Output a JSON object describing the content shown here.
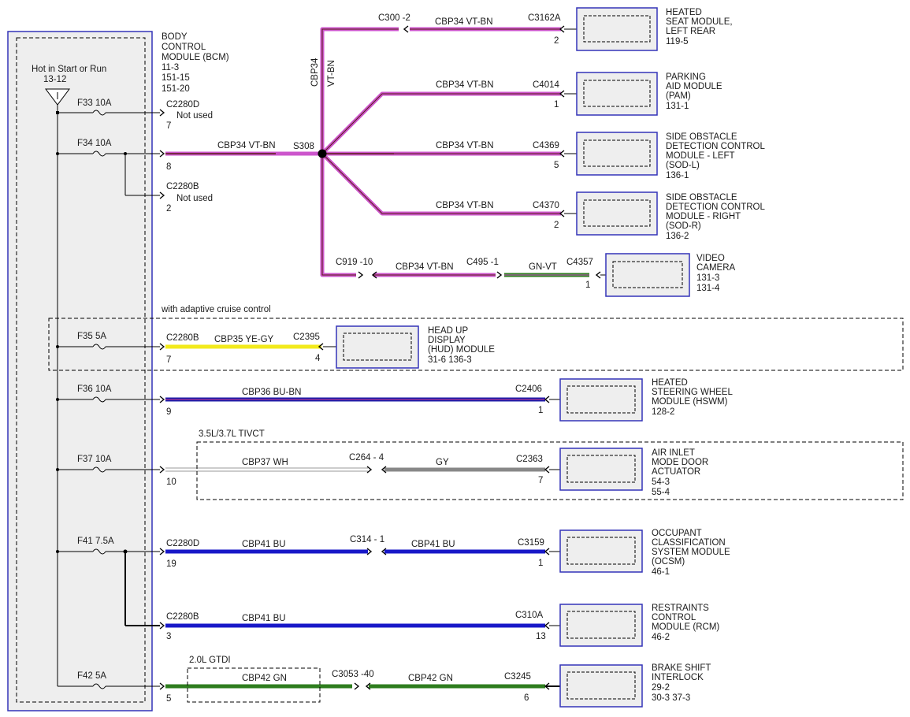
{
  "bcm": {
    "label": [
      "BODY",
      "CONTROL",
      "MODULE (BCM)"
    ],
    "refs": [
      "11-3",
      "151-15",
      "151-20"
    ],
    "hot_label": "Hot in Start or Run",
    "hot_ref": "13-12"
  },
  "fuses": [
    {
      "label": "F33  10A"
    },
    {
      "label": "F34  10A"
    },
    {
      "label": "F35  5A"
    },
    {
      "label": "F36  10A"
    },
    {
      "label": "F37  10A"
    },
    {
      "label": "F41  7.5A"
    },
    {
      "label": "F42  5A"
    }
  ],
  "notes": {
    "acc": "with adaptive cruise control",
    "tivct": "3.5L/3.7L TIVCT",
    "gtdi": "2.0L GTDI"
  },
  "splice": "S308",
  "bcm_connectors": [
    {
      "name": "C2280D",
      "pin": "7",
      "extra": "Not used"
    },
    {
      "name": "",
      "pin": "8",
      "extra": ""
    },
    {
      "name": "C2280B",
      "pin": "2",
      "extra": "Not used"
    },
    {
      "name": "C2280B",
      "pin": "7",
      "extra": ""
    },
    {
      "name": "",
      "pin": "9",
      "extra": ""
    },
    {
      "name": "",
      "pin": "10",
      "extra": ""
    },
    {
      "name": "C2280D",
      "pin": "19",
      "extra": ""
    },
    {
      "name": "C2280B",
      "pin": "3",
      "extra": ""
    },
    {
      "name": "",
      "pin": "5",
      "extra": ""
    }
  ],
  "circuits": [
    {
      "id": "c300",
      "text": "C300   -2"
    },
    {
      "id": "cbp34_rear",
      "text": "CBP34     VT-BN"
    },
    {
      "id": "c3162a",
      "text": "C3162A",
      "pin": "2"
    },
    {
      "id": "cbp34_v",
      "text": "CBP34"
    },
    {
      "id": "vtbn_v",
      "text": "VT-BN"
    },
    {
      "id": "cbp34_pam",
      "text": "CBP34     VT-BN"
    },
    {
      "id": "c4014",
      "text": "C4014",
      "pin": "1"
    },
    {
      "id": "cbp34_main",
      "text": "CBP34     VT-BN"
    },
    {
      "id": "cbp34_sodl",
      "text": "CBP34     VT-BN"
    },
    {
      "id": "c4369",
      "text": "C4369",
      "pin": "5"
    },
    {
      "id": "cbp34_sodr",
      "text": "CBP34     VT-BN"
    },
    {
      "id": "c4370",
      "text": "C4370",
      "pin": "2"
    },
    {
      "id": "c919",
      "text": "C919   -10"
    },
    {
      "id": "cbp34_cam",
      "text": "CBP34     VT-BN"
    },
    {
      "id": "c495",
      "text": "C495   -1"
    },
    {
      "id": "gnvt",
      "text": "GN-VT"
    },
    {
      "id": "c4357",
      "text": "C4357",
      "pin": "1"
    },
    {
      "id": "cbp35",
      "text": "CBP35     YE-GY"
    },
    {
      "id": "c2395",
      "text": "C2395",
      "pin": "4"
    },
    {
      "id": "cbp36",
      "text": "CBP36     BU-BN"
    },
    {
      "id": "c2406",
      "text": "C2406",
      "pin": "1"
    },
    {
      "id": "cbp37",
      "text": "CBP37     WH"
    },
    {
      "id": "c264",
      "text": "C264   - 4"
    },
    {
      "id": "gy",
      "text": "GY"
    },
    {
      "id": "c2363",
      "text": "C2363",
      "pin": "7"
    },
    {
      "id": "cbp41a",
      "text": "CBP41     BU"
    },
    {
      "id": "c314",
      "text": "C314   - 1"
    },
    {
      "id": "cbp41b",
      "text": "CBP41     BU"
    },
    {
      "id": "c3159",
      "text": "C3159",
      "pin": "1"
    },
    {
      "id": "cbp41c",
      "text": "CBP41     BU"
    },
    {
      "id": "c310a",
      "text": "C310A",
      "pin": "13"
    },
    {
      "id": "cbp42a",
      "text": "CBP42     GN"
    },
    {
      "id": "c3053",
      "text": "C3053    -40"
    },
    {
      "id": "cbp42b",
      "text": "CBP42     GN"
    },
    {
      "id": "c3245",
      "text": "C3245",
      "pin": "6"
    }
  ],
  "modules": [
    {
      "id": "heated-seat",
      "lines": [
        "HEATED",
        "SEAT MODULE,",
        "LEFT REAR",
        "119-5"
      ]
    },
    {
      "id": "pam",
      "lines": [
        "PARKING",
        "AID MODULE",
        "(PAM)",
        "131-1"
      ]
    },
    {
      "id": "sod-l",
      "lines": [
        "SIDE OBSTACLE",
        "DETECTION CONTROL",
        "MODULE - LEFT",
        "(SOD-L)",
        "136-1"
      ]
    },
    {
      "id": "sod-r",
      "lines": [
        "SIDE OBSTACLE",
        "DETECTION CONTROL",
        "MODULE - RIGHT",
        "(SOD-R)",
        "136-2"
      ]
    },
    {
      "id": "camera",
      "lines": [
        "VIDEO",
        "CAMERA",
        "131-3",
        "131-4"
      ]
    },
    {
      "id": "hud",
      "lines": [
        "HEAD UP",
        "DISPLAY",
        "(HUD) MODULE",
        "31-6      136-3"
      ]
    },
    {
      "id": "hswm",
      "lines": [
        "HEATED",
        "STEERING WHEEL",
        "MODULE (HSWM)",
        "128-2"
      ]
    },
    {
      "id": "air-inlet",
      "lines": [
        "AIR INLET",
        "MODE DOOR",
        "ACTUATOR",
        "54-3",
        "55-4"
      ]
    },
    {
      "id": "ocsm",
      "lines": [
        "OCCUPANT",
        "CLASSIFICATION",
        "SYSTEM MODULE",
        "(OCSM)",
        "46-1"
      ]
    },
    {
      "id": "rcm",
      "lines": [
        "RESTRAINTS",
        "CONTROL",
        "MODULE (RCM)",
        "46-2"
      ]
    },
    {
      "id": "bsi",
      "lines": [
        "BRAKE SHIFT",
        "INTERLOCK",
        "29-2",
        "30-3      37-3"
      ]
    }
  ],
  "colors": {
    "vt_bn": "#cc55cc",
    "vt_bn_stripe": "#5a1e14",
    "ye_gy": "#f2ea1c",
    "bu_bn": "#1a1aa8",
    "bu_bn_stripe": "#d44090",
    "gy": "#888888",
    "bu": "#1818c8",
    "gn": "#2e7d1e",
    "gn_vt": "#2e7d1e",
    "module_border": "#3434b8",
    "module_fill": "#eeeeee"
  }
}
